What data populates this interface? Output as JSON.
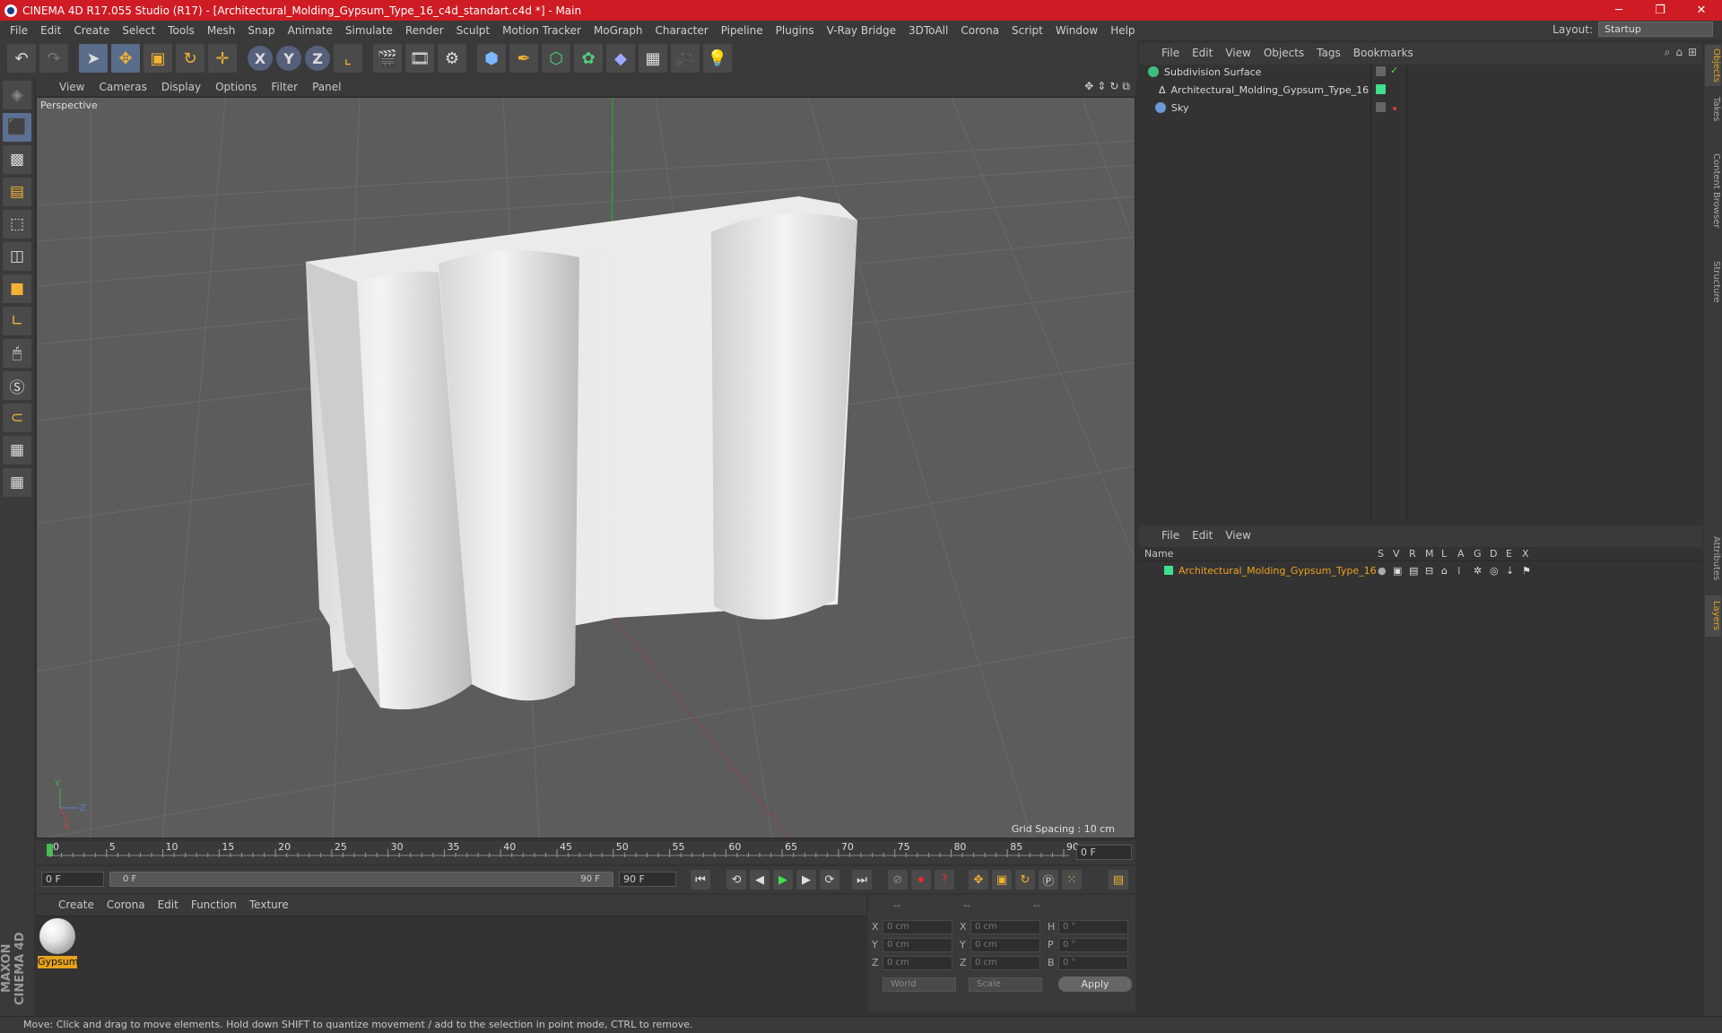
{
  "app": {
    "title": "CINEMA 4D R17.055 Studio (R17) - [Architectural_Molding_Gypsum_Type_16_c4d_standart.c4d *] - Main",
    "window_buttons": [
      "─",
      "❐",
      "✕"
    ]
  },
  "menu": {
    "items": [
      "File",
      "Edit",
      "Create",
      "Select",
      "Tools",
      "Mesh",
      "Snap",
      "Animate",
      "Simulate",
      "Render",
      "Sculpt",
      "Motion Tracker",
      "MoGraph",
      "Character",
      "Pipeline",
      "Plugins",
      "V-Ray Bridge",
      "3DToAll",
      "Corona",
      "Script",
      "Window",
      "Help"
    ],
    "layout_label": "Layout:",
    "layout_value": "Startup"
  },
  "viewport": {
    "menu": [
      "View",
      "Cameras",
      "Display",
      "Options",
      "Filter",
      "Panel"
    ],
    "label": "Perspective",
    "grid_spacing": "Grid Spacing : 10 cm"
  },
  "timeline": {
    "ticks": [
      "0",
      "5",
      "10",
      "15",
      "20",
      "25",
      "30",
      "35",
      "40",
      "45",
      "50",
      "55",
      "60",
      "65",
      "70",
      "75",
      "80",
      "85",
      "90"
    ],
    "current_frame": "0 F",
    "start_field": "0 F",
    "slider_start": "0 F",
    "slider_end": "90 F",
    "end_field": "90 F"
  },
  "materials": {
    "menu": [
      "Create",
      "Corona",
      "Edit",
      "Function",
      "Texture"
    ],
    "items": [
      {
        "name": "Gypsum"
      }
    ]
  },
  "coordinates": {
    "headers": [
      "--",
      "--",
      "--"
    ],
    "rows": [
      {
        "a": "X",
        "av": "0 cm",
        "b": "X",
        "bv": "0 cm",
        "c": "H",
        "cv": "0 °"
      },
      {
        "a": "Y",
        "av": "0 cm",
        "b": "Y",
        "bv": "0 cm",
        "c": "P",
        "cv": "0 °"
      },
      {
        "a": "Z",
        "av": "0 cm",
        "b": "Z",
        "bv": "0 cm",
        "c": "B",
        "cv": "0 °"
      }
    ],
    "mode1": "World",
    "mode2": "Scale",
    "apply": "Apply"
  },
  "objects": {
    "menu": [
      "File",
      "Edit",
      "View",
      "Objects",
      "Tags",
      "Bookmarks"
    ],
    "items": [
      {
        "name": "Subdivision Surface",
        "icon_color": "#3fbf7f"
      },
      {
        "name": "Architectural_Molding_Gypsum_Type_16",
        "icon_color": "#d0d0d0"
      },
      {
        "name": "Sky",
        "icon_color": "#6a9ad8"
      }
    ]
  },
  "layers": {
    "menu": [
      "File",
      "Edit",
      "View"
    ],
    "columns": [
      "Name",
      "S",
      "V",
      "R",
      "M",
      "L",
      "A",
      "G",
      "D",
      "E",
      "X"
    ],
    "items": [
      {
        "name": "Architectural_Molding_Gypsum_Type_16",
        "color": "#3fdf8f"
      }
    ]
  },
  "side_tabs": [
    "Objects",
    "Takes",
    "Content Browser",
    "Structure",
    "Attributes",
    "Layers"
  ],
  "status": {
    "text": "Move: Click and drag to move elements. Hold down SHIFT to quantize movement / add to the selection in point mode, CTRL to remove."
  },
  "brand": {
    "text": "MAXON CINEMA 4D"
  },
  "colors": {
    "titlebar": "#cf1b24",
    "accent": "#e6a21d",
    "panel": "#3a3a3a"
  }
}
